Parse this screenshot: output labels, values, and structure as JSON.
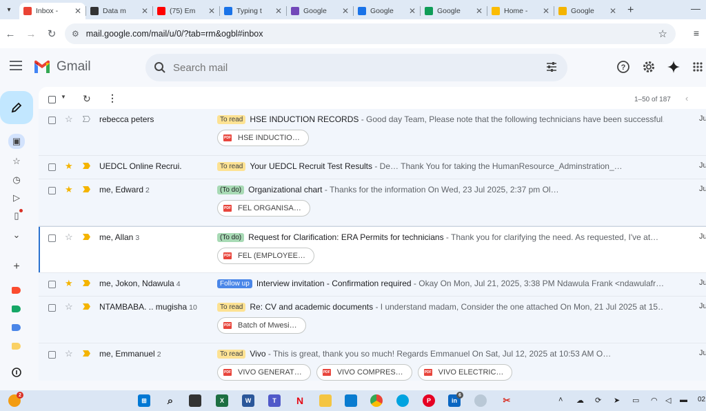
{
  "browser": {
    "tabs": [
      {
        "title": "Inbox - ",
        "active": true,
        "favicon": "gmail-icon",
        "color": "#ea4335"
      },
      {
        "title": "Data m",
        "favicon": "chatgpt-icon",
        "color": "#333333"
      },
      {
        "title": "(75) Em",
        "favicon": "youtube-icon",
        "color": "#ff0000"
      },
      {
        "title": "Typing t",
        "favicon": "typing-icon",
        "color": "#1a73e8"
      },
      {
        "title": "Google",
        "favicon": "google-forms-icon",
        "color": "#7248b9"
      },
      {
        "title": "Google",
        "favicon": "google-calendar-icon",
        "color": "#1a73e8"
      },
      {
        "title": "Google",
        "favicon": "google-sheets-icon",
        "color": "#0f9d58"
      },
      {
        "title": "Home -",
        "favicon": "google-drive-icon",
        "color": "#fbbc04"
      },
      {
        "title": "Google",
        "favicon": "google-slides-icon",
        "color": "#f4b400"
      }
    ],
    "url": "mail.google.com/mail/u/0/?tab=rm&ogbl#inbox"
  },
  "gmail": {
    "brand": "Gmail",
    "search_placeholder": "Search mail",
    "pagination": "1–50 of 187",
    "emails": [
      {
        "sender": "rebecca peters",
        "count": "",
        "starred": false,
        "important": false,
        "label": "To read",
        "label_color": "yellow",
        "subject": "HSE INDUCTION RECORDS",
        "snippet": " - Good day Team, Please note that the following technicians have been successful…",
        "date": "Ju",
        "attachments": [
          "HSE INDUCTIO…"
        ],
        "highlight": false
      },
      {
        "sender": "UEDCL Online Recrui.",
        "count": "",
        "starred": true,
        "important": true,
        "label": "To read",
        "label_color": "yellow",
        "subject": "Your UEDCL Recruit Test Results",
        "snippet": " - De… Thank You for taking the HumanResource_Adminstration_…",
        "date": "Ju",
        "attachments": [],
        "highlight": false
      },
      {
        "sender": "me, Edward",
        "count": "2",
        "starred": true,
        "important": true,
        "label": "(To do)",
        "label_color": "green",
        "subject": "Organizational chart",
        "snippet": " - Thanks for the information On Wed, 23 Jul 2025, 2:37 pm Ol…",
        "date": "Ju",
        "attachments": [
          "FEL ORGANISA…"
        ],
        "highlight": false
      },
      {
        "sender": "me, Allan",
        "count": "3",
        "starred": false,
        "important": true,
        "label": "(To do)",
        "label_color": "green",
        "subject": "Request for Clarification: ERA Permits for technicians",
        "snippet": " - Thank you for clarifying the need. As requested, I've at…",
        "date": "Ju",
        "attachments": [
          "FEL (EMPLOYEE…"
        ],
        "highlight": true
      },
      {
        "sender": "me, Jokon, Ndawula",
        "count": "4",
        "starred": true,
        "important": true,
        "label": "Follow up",
        "label_color": "blue",
        "subject": "Interview invitation - Confirmation required",
        "snippet": " - Okay On Mon, Jul 21, 2025, 3:38 PM Ndawula Frank <ndawulafr…",
        "date": "Ju",
        "attachments": [],
        "highlight": false
      },
      {
        "sender": "NTAMBABA. .. mugisha",
        "count": "10",
        "starred": false,
        "important": true,
        "label": "To read",
        "label_color": "yellow",
        "subject": "Re: CV and academic documents",
        "snippet": " - I understand madam, Consider the one attached On Mon, 21 Jul 2025 at 15…",
        "date": "Ju",
        "attachments": [
          "Batch of Mwesi…"
        ],
        "highlight": false
      },
      {
        "sender": "me, Emmanuel",
        "count": "2",
        "starred": false,
        "important": true,
        "label": "To read",
        "label_color": "yellow",
        "subject": "Vivo",
        "snippet": " - This is great, thank you so much! Regards Emmanuel On Sat, Jul 12, 2025 at 10:53 AM O…",
        "date": "Ju",
        "attachments": [
          "VIVO GENERAT…",
          "VIVO COMPRES…",
          "VIVO ELECTRIC…"
        ],
        "highlight": false
      }
    ]
  },
  "taskbar": {
    "weather_badge": "2",
    "linkedin_badge": "6",
    "clock": "02"
  },
  "pdf_tag": "PDF"
}
